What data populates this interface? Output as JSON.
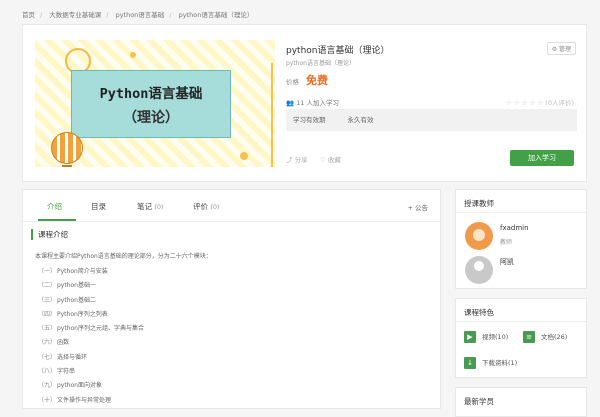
{
  "breadcrumb": [
    "首页",
    "大数据专业基础课",
    "python语言基础",
    "python语言基础（理论）"
  ],
  "course": {
    "cover_line1": "Python语言基础",
    "cover_line2": "（理论）",
    "title": "python语言基础（理论）",
    "subtitle": "python语言基础（理论）",
    "manage_label": "⚙ 管理",
    "price_label": "价格",
    "price_value": "免费",
    "joined_text": "11 人加入学习",
    "stars_text": "☆ ☆ ☆ ☆ ☆",
    "rating_count": "(0人评价)",
    "validity_label": "学习有效期",
    "validity_value": "永久有效",
    "share_label": "分享",
    "fav_label": "收藏",
    "join_button": "加入学习"
  },
  "tabs": [
    {
      "label": "介绍",
      "count": ""
    },
    {
      "label": "目录",
      "count": ""
    },
    {
      "label": "笔记",
      "count": "(0)"
    },
    {
      "label": "评价",
      "count": "(0)"
    }
  ],
  "notice_label": "+ 公告",
  "intro": {
    "heading": "课程介绍",
    "text": "本课程主要介绍Python语言基础的理论部分，分为二十六个模块：",
    "items": [
      {
        "num": "（一）",
        "text": "Python简介与安装"
      },
      {
        "num": "（二）",
        "text": "python基础一"
      },
      {
        "num": "（三）",
        "text": "python基础二"
      },
      {
        "num": "（四）",
        "text": "Python序列之列表"
      },
      {
        "num": "（五）",
        "text": "python序列之元组、字典与集合"
      },
      {
        "num": "（六）",
        "text": "函数"
      },
      {
        "num": "（七）",
        "text": "选择与循环"
      },
      {
        "num": "（八）",
        "text": "字符串"
      },
      {
        "num": "（九）",
        "text": "python面向对象"
      },
      {
        "num": "（十）",
        "text": "文件操作与异常处理"
      }
    ]
  },
  "teachers": {
    "heading": "授课教师",
    "list": [
      {
        "name": "fxadmin",
        "role": "教师"
      },
      {
        "name": "阿凯",
        "role": ""
      }
    ]
  },
  "features": {
    "heading": "课程特色",
    "video": "视频(10)",
    "doc": "文档(26)",
    "download": "下载资料(1)"
  },
  "latest": {
    "heading": "最新学员"
  }
}
